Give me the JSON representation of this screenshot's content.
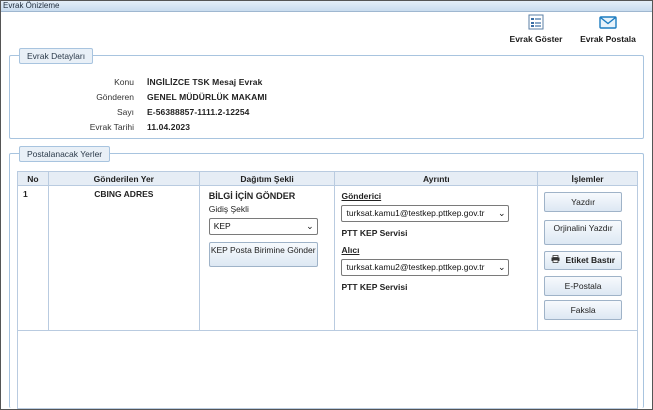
{
  "window": {
    "title": "Evrak Önizleme"
  },
  "toolbar": {
    "goster_label": "Evrak Göster",
    "postala_label": "Evrak Postala"
  },
  "details": {
    "legend": "Evrak Detayları",
    "rows": [
      {
        "label": "Konu",
        "value": "İNGİLİZCE TSK Mesaj Evrak"
      },
      {
        "label": "Gönderen",
        "value": "GENEL MÜDÜRLÜK MAKAMI"
      },
      {
        "label": "Sayı",
        "value": "E-56388857-1111.2-12254"
      },
      {
        "label": "Evrak Tarihi",
        "value": "11.04.2023"
      }
    ]
  },
  "postal": {
    "legend": "Postalanacak Yerler",
    "columns": [
      "No",
      "Gönderilen Yer",
      "Dağıtım Şekli",
      "Ayrıntı",
      "İşlemler"
    ],
    "row": {
      "no": "1",
      "yer": "CBING ADRES",
      "dagitim_title": "BİLGİ İÇİN GÖNDER",
      "gidis_label": "Gidiş Şekli",
      "gidis_value": "KEP",
      "kep_button": "KEP Posta Birimine Gönder",
      "gonderici_label": "Gönderici",
      "gonderici_value": "turksat.kamu1@testkep.pttkep.gov.tr",
      "gonderici_service": "PTT KEP Servisi",
      "alici_label": "Alıcı",
      "alici_value": "turksat.kamu2@testkep.pttkep.gov.tr",
      "alici_service": "PTT KEP Servisi"
    },
    "actions": {
      "yazdir": "Yazdır",
      "orjinal_yazdir": "Orjinalini Yazdır",
      "etiket": "Etiket Bastır",
      "epostala": "E-Postala",
      "faksla": "Faksla"
    }
  },
  "icons": {
    "goster": "document-list-icon",
    "postala": "envelope-send-icon",
    "printer": "printer-icon"
  }
}
